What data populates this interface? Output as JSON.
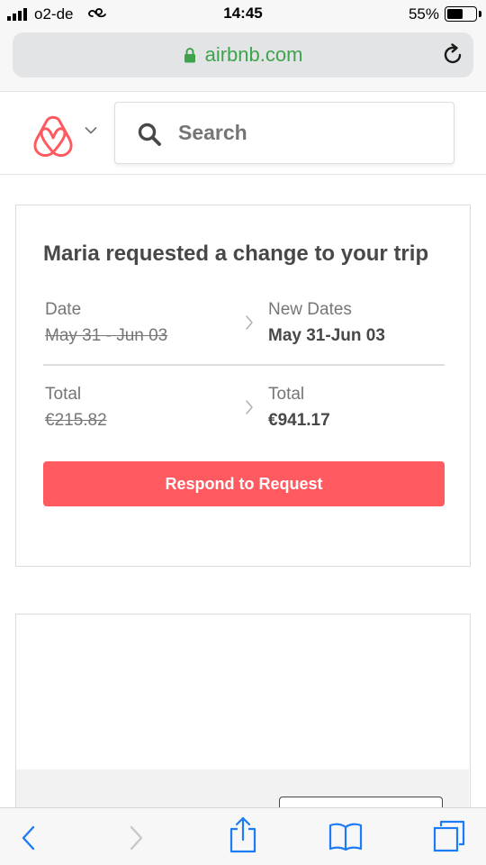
{
  "status_bar": {
    "carrier": "o2-de",
    "time": "14:45",
    "battery_percent": "55%",
    "battery_level": 0.55,
    "icons": [
      "signal-icon",
      "link-icon",
      "battery-icon"
    ]
  },
  "browser": {
    "url": "airbnb.com",
    "icons": [
      "lock-icon",
      "reload-icon"
    ],
    "url_color": "#3fa34d"
  },
  "site_header": {
    "logo": "airbnb-logo-icon",
    "menu_icon": "chevron-down-icon",
    "search": {
      "placeholder": "Search",
      "value": ""
    }
  },
  "request_card": {
    "title": "Maria requested a change to your trip",
    "rows": [
      {
        "old_label": "Date",
        "old_value": "May 31 - Jun 03",
        "new_label": "New Dates",
        "new_value": "May 31-Jun 03"
      },
      {
        "old_label": "Total",
        "old_value": "€215.82",
        "new_label": "Total",
        "new_value": "€941.17"
      }
    ],
    "button_label": "Respond to Request",
    "accent_color": "#ff5a5f"
  },
  "toolbar": {
    "icons": [
      "back-icon",
      "forward-icon",
      "share-icon",
      "bookmarks-icon",
      "tabs-icon"
    ]
  }
}
